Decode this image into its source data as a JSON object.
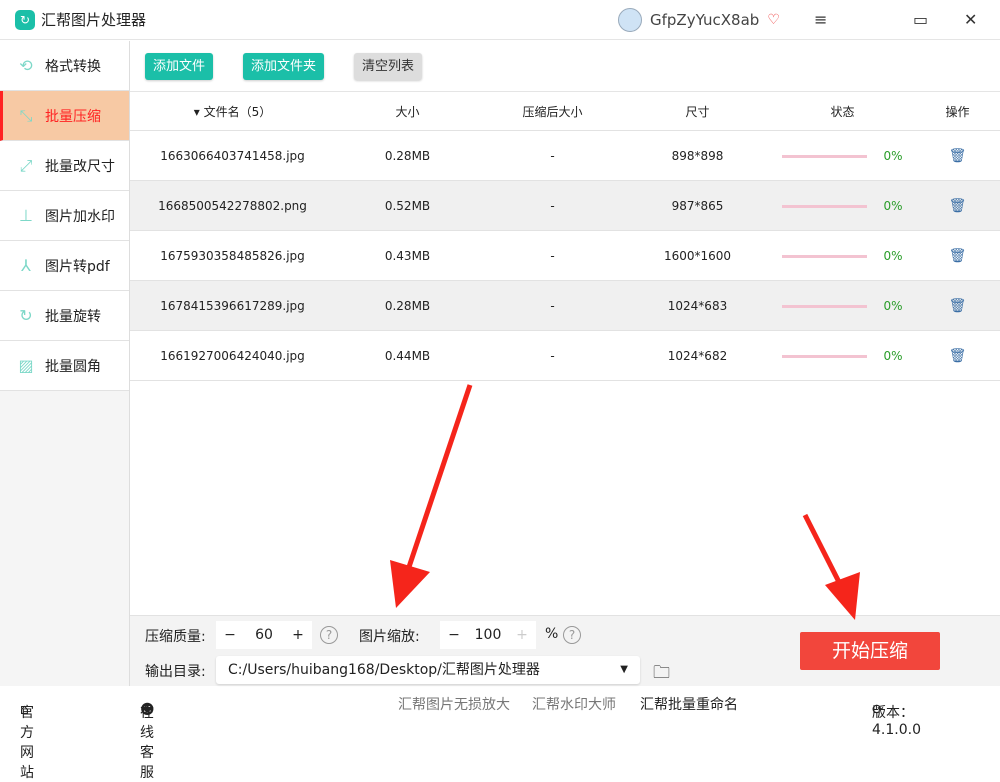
{
  "app": {
    "title": "汇帮图片处理器",
    "username": "GfpZyYucX8ab"
  },
  "sidebar": {
    "items": [
      {
        "label": "格式转换",
        "icon": "convert-icon"
      },
      {
        "label": "批量压缩",
        "icon": "compress-icon",
        "active": true
      },
      {
        "label": "批量改尺寸",
        "icon": "resize-icon"
      },
      {
        "label": "图片加水印",
        "icon": "watermark-icon"
      },
      {
        "label": "图片转pdf",
        "icon": "pdf-icon"
      },
      {
        "label": "批量旋转",
        "icon": "rotate-icon"
      },
      {
        "label": "批量圆角",
        "icon": "image-icon"
      }
    ]
  },
  "toolbar": {
    "add_file": "添加文件",
    "add_folder": "添加文件夹",
    "clear": "清空列表"
  },
  "table": {
    "headers": [
      "文件名（5）",
      "大小",
      "压缩后大小",
      "尺寸",
      "状态",
      "操作"
    ],
    "rows": [
      {
        "name": "1663066403741458.jpg",
        "size": "0.28MB",
        "after": "-",
        "dim": "898*898",
        "progress": "0%"
      },
      {
        "name": "1668500542278802.png",
        "size": "0.52MB",
        "after": "-",
        "dim": "987*865",
        "progress": "0%"
      },
      {
        "name": "1675930358485826.jpg",
        "size": "0.43MB",
        "after": "-",
        "dim": "1600*1600",
        "progress": "0%"
      },
      {
        "name": "1678415396617289.jpg",
        "size": "0.28MB",
        "after": "-",
        "dim": "1024*683",
        "progress": "0%"
      },
      {
        "name": "1661927006424040.jpg",
        "size": "0.44MB",
        "after": "-",
        "dim": "1024*682",
        "progress": "0%"
      }
    ]
  },
  "settings": {
    "quality_label": "压缩质量:",
    "quality": "60",
    "scale_label": "图片缩放:",
    "scale": "100",
    "percent": "%",
    "output_label": "输出目录:",
    "output_dir": "C:/Users/huibang168/Desktop/汇帮图片处理器"
  },
  "start_button": "开始压缩",
  "footer": {
    "website": "官方网站",
    "service": "在线客服",
    "link1": "汇帮图片无损放大",
    "link2": "汇帮水印大师",
    "link3": "汇帮批量重命名",
    "version": "版本：4.1.0.0"
  },
  "colors": {
    "accent": "#1bbfa8",
    "start": "#f2463c",
    "active_bg": "#f7c9a4"
  }
}
